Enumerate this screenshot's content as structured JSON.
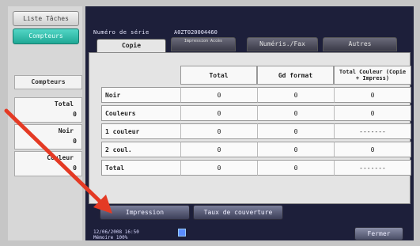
{
  "left_panel": {
    "job_list_label": "Liste Tâches",
    "counters_button": "Compteurs",
    "counters_title": "Compteurs",
    "items": [
      {
        "label": "Total",
        "value": "0"
      },
      {
        "label": "Noir",
        "value": "0"
      },
      {
        "label": "Couleur",
        "value": "0"
      }
    ]
  },
  "header": {
    "serial_label": "Numéro de série",
    "serial_value": "A0ZT020004460"
  },
  "tabs": {
    "copie": "Copie",
    "impression": "Impression Accès",
    "numeris_fax": "Numéris./Fax",
    "autres": "Autres"
  },
  "table": {
    "headers": [
      "",
      "Total",
      "Gd format",
      "Total Couleur (Copie + Impress)"
    ],
    "rows": [
      {
        "label": "Noir",
        "total": "0",
        "gd": "0",
        "tc": "0"
      },
      {
        "label": "Couleurs",
        "total": "0",
        "gd": "0",
        "tc": "0"
      },
      {
        "label": "1 couleur",
        "total": "0",
        "gd": "0",
        "tc": "-------"
      },
      {
        "label": "2 coul.",
        "total": "0",
        "gd": "0",
        "tc": "0"
      },
      {
        "label": "Total",
        "total": "0",
        "gd": "0",
        "tc": "-------"
      }
    ]
  },
  "bottom": {
    "impression_button": "Impression",
    "taux_button": "Taux de couverture",
    "date": "12/06/2008",
    "time": "16:50",
    "memory_label": "Mémoire",
    "memory_value": "100%",
    "fermer_button": "Fermer"
  },
  "annotation": {
    "arrow_color": "#e43a24"
  },
  "colors": {
    "accent": "#1fa895",
    "screen": "#1d1f3a"
  }
}
